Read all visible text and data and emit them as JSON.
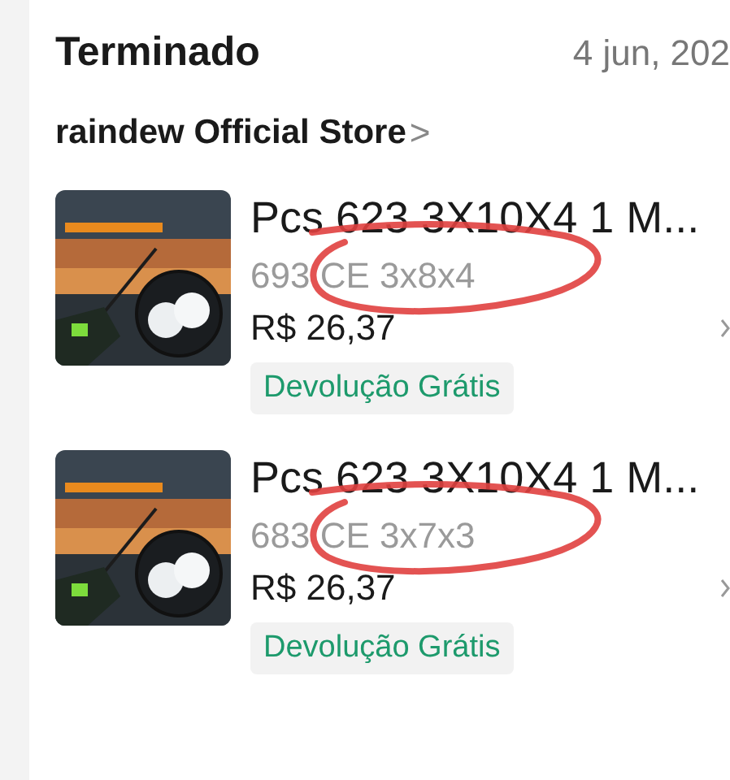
{
  "order": {
    "status": "Terminado",
    "date": "4 jun, 202"
  },
  "store": {
    "name": "raindew Official Store",
    "chevron": ">"
  },
  "items": [
    {
      "title": "Pcs 623 3X10X4 1 M...",
      "variant": "693 CE 3x8x4",
      "price": "R$ 26,37",
      "badge": "Devolução Grátis",
      "marked": true
    },
    {
      "title": "Pcs 623 3X10X4 1 M...",
      "variant": "683 CE 3x7x3",
      "price": "R$ 26,37",
      "badge": "Devolução Grátis",
      "marked": true
    }
  ]
}
